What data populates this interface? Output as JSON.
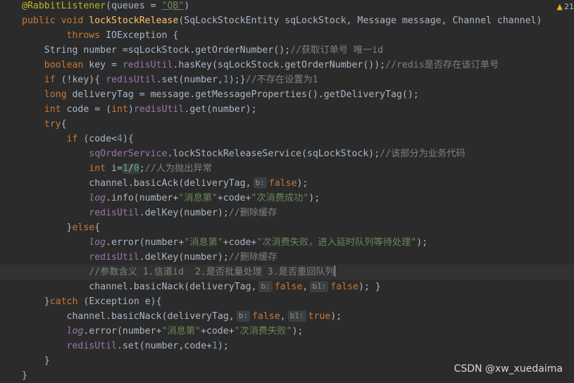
{
  "warnings": {
    "count": "21"
  },
  "watermark": "CSDN @xw_xuedaima",
  "code": {
    "l1a": "@RabbitListener",
    "l1b": "(queues = ",
    "l1c": "\"QB\"",
    "l1d": ")",
    "l2a": "public void ",
    "l2b": "lockStockRelease",
    "l2c": "(SqLockStockEntity sqLockStock, Message message, Channel channel)",
    "l3a": "throws ",
    "l3b": "IOException {",
    "l4a": "String number =sqLockStock.getOrderNumber();",
    "l4b": "//获取订单号 唯一id",
    "l5a": "boolean ",
    "l5b": "key = ",
    "l5c": "redisUtil",
    "l5d": ".hasKey(sqLockStock.getOrderNumber());",
    "l5e": "//redis是否存在该订单号",
    "l6a": "if ",
    "l6b": "(!key){ ",
    "l6c": "redisUtil",
    "l6d": ".set(number,",
    "l6e": "1",
    "l6f": ");}",
    "l6g": "//不存在设置为1",
    "l7a": "long ",
    "l7b": "deliveryTag = message.getMessageProperties().getDeliveryTag();",
    "l8a": "int ",
    "l8b": "code = (",
    "l8c": "int",
    "l8d": ")",
    "l8e": "redisUtil",
    "l8f": ".get(number);",
    "l9a": "try",
    "l9b": "{",
    "l10a": "if ",
    "l10b": "(code<",
    "l10c": "4",
    "l10d": "){",
    "l11a": "sqOrderService",
    "l11b": ".lockStockReleaseService(sqLockStock);",
    "l11c": "//该部分为业务代码",
    "l12a": "int ",
    "l12b": "i=",
    "l12c": "1",
    "l12d": "/",
    "l12e": "0",
    "l12f": ";",
    "l12g": "//人为抛出异常",
    "l13a": "channel.basicAck(deliveryTag,",
    "l13b": "b:",
    "l13c": "false",
    "l13d": ");",
    "l14a": "log",
    "l14b": ".info(number+",
    "l14c": "\"消息第\"",
    "l14d": "+code+",
    "l14e": "\"次消费成功\"",
    "l14f": ");",
    "l15a": "redisUtil",
    "l15b": ".delKey(number);",
    "l15c": "//删除缓存",
    "l16a": "}",
    "l16b": "else",
    "l16c": "{",
    "l17a": "log",
    "l17b": ".error(number+",
    "l17c": "\"消息第\"",
    "l17d": "+code+",
    "l17e": "\"次消费失败，进入延时队列等待处理\"",
    "l17f": ");",
    "l18a": "redisUtil",
    "l18b": ".delKey(number);",
    "l18c": "//删除缓存",
    "l19a": "//参数含义 1.信道id  2.是否批量处理 3.是否重回队列",
    "l20a": "channel.basicNack(deliveryTag,",
    "l20b": "b:",
    "l20c": "false",
    "l20d": ",",
    "l20e": "b1:",
    "l20f": "false",
    "l20g": "); }",
    "l21a": "}",
    "l21b": "catch ",
    "l21c": "(Exception e){",
    "l22a": "channel.basicNack(deliveryTag,",
    "l22b": "b:",
    "l22c": "false",
    "l22d": ",",
    "l22e": "b1:",
    "l22f": "true",
    "l22g": ");",
    "l23a": "log",
    "l23b": ".error(number+",
    "l23c": "\"消息第\"",
    "l23d": "+code+",
    "l23e": "\"次消费失败\"",
    "l23f": ");",
    "l24a": "redisUtil",
    "l24b": ".set(number,code+",
    "l24c": "1",
    "l24d": ");",
    "l25a": "}",
    "l26a": "}"
  }
}
